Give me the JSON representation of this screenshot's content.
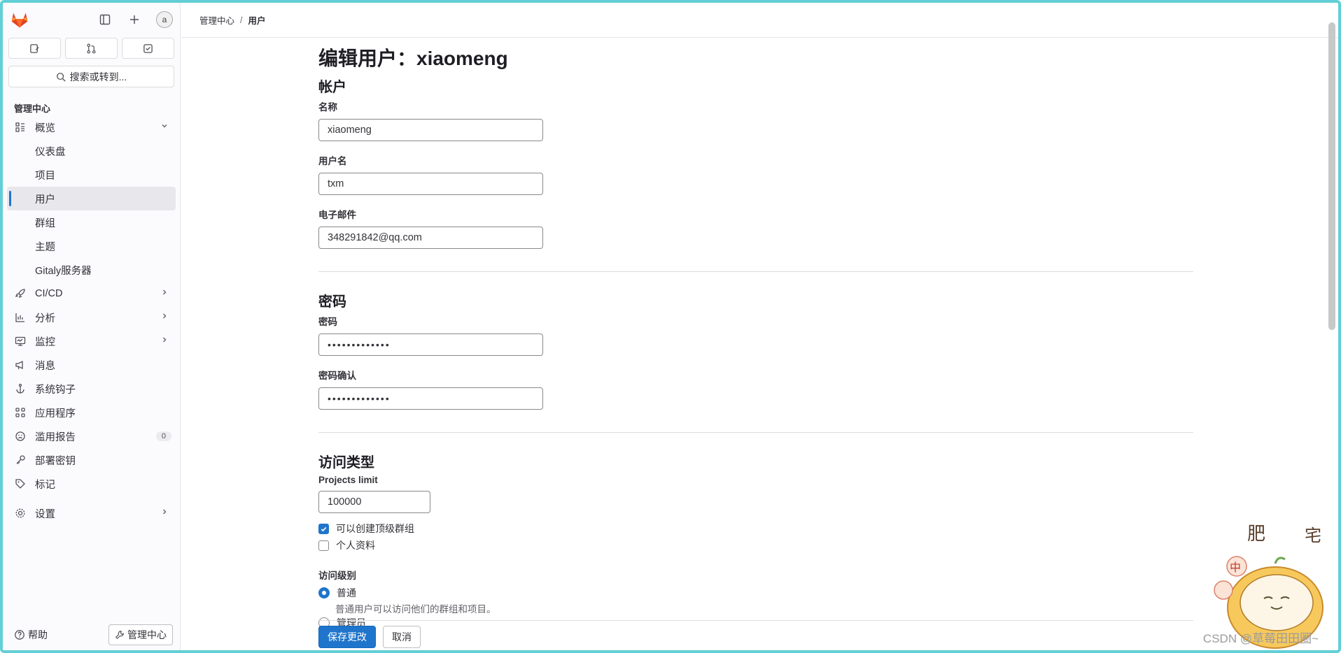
{
  "sidebar": {
    "search_label": "搜索或转到...",
    "avatar_alt": "a",
    "section_title": "管理中心",
    "overview": {
      "label": "概览",
      "children": [
        "仪表盘",
        "项目",
        "用户",
        "群组",
        "主题",
        "Gitaly服务器"
      ],
      "active_index": 2
    },
    "items": [
      {
        "label": "CI/CD",
        "icon": "rocket-icon",
        "chevron": true
      },
      {
        "label": "分析",
        "icon": "chart-icon",
        "chevron": true
      },
      {
        "label": "监控",
        "icon": "monitor-icon",
        "chevron": true
      },
      {
        "label": "消息",
        "icon": "bullhorn-icon",
        "chevron": false
      },
      {
        "label": "系统钩子",
        "icon": "anchor-icon",
        "chevron": false
      },
      {
        "label": "应用程序",
        "icon": "apps-icon",
        "chevron": false
      },
      {
        "label": "滥用报告",
        "icon": "abuse-icon",
        "chevron": false,
        "badge": "0"
      },
      {
        "label": "部署密钥",
        "icon": "key-icon",
        "chevron": false
      },
      {
        "label": "标记",
        "icon": "label-icon",
        "chevron": false
      }
    ],
    "settings_label": "设置",
    "help_label": "帮助",
    "admin_label": "管理中心"
  },
  "breadcrumb": {
    "parent": "管理中心",
    "current": "用户"
  },
  "page": {
    "title": "编辑用户：xiaomeng",
    "account": {
      "heading": "帐户",
      "name_label": "名称",
      "name_value": "xiaomeng",
      "username_label": "用户名",
      "username_value": "txm",
      "email_label": "电子邮件",
      "email_value": "348291842@qq.com"
    },
    "password": {
      "heading": "密码",
      "password_label": "密码",
      "password_value": "•••••••••••••",
      "confirm_label": "密码确认",
      "confirm_value": "•••••••••••••"
    },
    "access": {
      "heading": "访问类型",
      "projects_limit_label": "Projects limit",
      "projects_limit_value": "100000",
      "can_create_group_label": "可以创建顶级群组",
      "can_create_group_checked": true,
      "private_profile_label": "个人资料",
      "private_profile_checked": false,
      "access_level_label": "访问级别",
      "regular_label": "普通",
      "regular_help": "普通用户可以访问他们的群组和项目。",
      "admin_label": "管理员"
    },
    "save_label": "保存更改",
    "cancel_label": "取消"
  },
  "overlay": {
    "watermark": "CSDN @草莓田田圈~"
  },
  "colors": {
    "accent": "#1f75cb",
    "frame": "#62cfd6",
    "logo": "#e24329"
  }
}
